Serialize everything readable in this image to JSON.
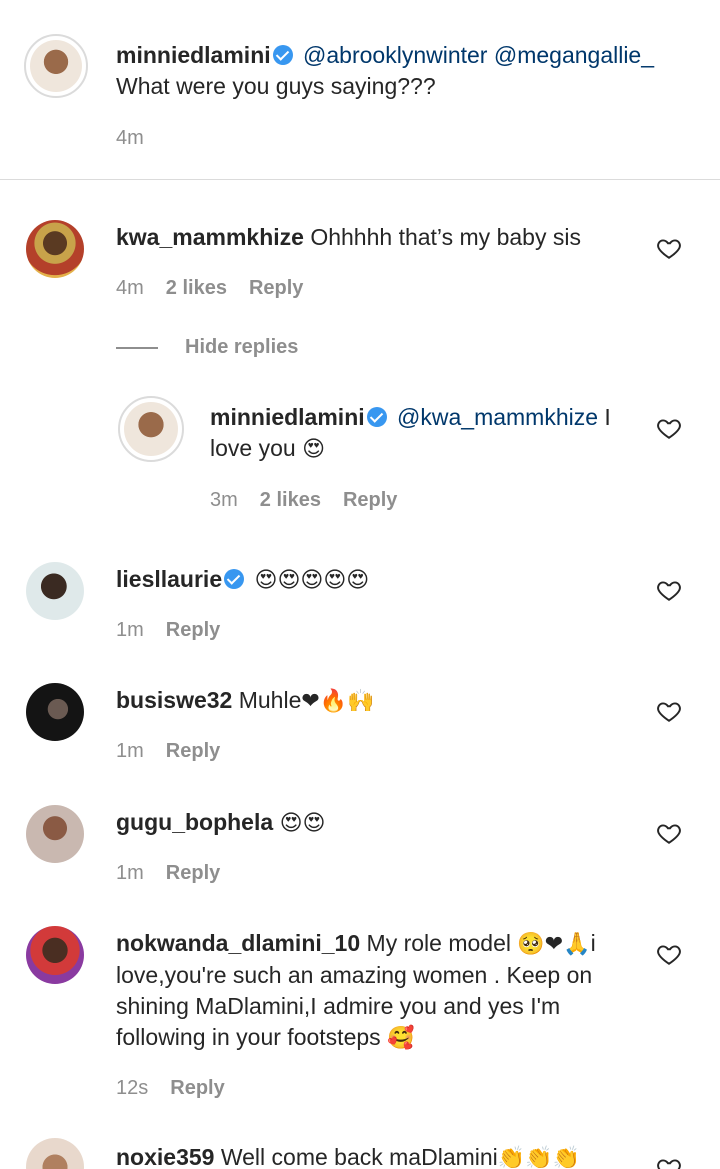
{
  "caption": {
    "username": "minniedlamini",
    "mentions": "@abrooklynwinter @megangallie_",
    "text": "What were you guys saying???",
    "time": "4m"
  },
  "comments": [
    {
      "username": "kwa_mammkhize",
      "text": "Ohhhhh that’s my baby sis",
      "time": "4m",
      "likes": "2 likes",
      "reply": "Reply",
      "hide_replies": "Hide replies"
    },
    {
      "username": "minniedlamini",
      "mention": "@kwa_mammkhize",
      "text_a": " I",
      "text_b": "love you",
      "emoji": "😍",
      "time": "3m",
      "likes": "2 likes",
      "reply": "Reply"
    },
    {
      "username": "liesllaurie",
      "emoji": "😍😍😍😍😍",
      "time": "1m",
      "reply": "Reply"
    },
    {
      "username": "busiswe32",
      "text": "Muhle",
      "emoji": "❤🔥🙌",
      "time": "1m",
      "reply": "Reply"
    },
    {
      "username": "gugu_bophela",
      "emoji": "😍😍",
      "time": "1m",
      "reply": "Reply"
    },
    {
      "username": "nokwanda_dlamini_10",
      "text_a": "My role model",
      "emoji_a": "🥺❤🙏",
      "text_b": "i",
      "line2": "love,you're such an amazing women . Keep on",
      "line3": "shining MaDlamini,I admire you and yes I'm",
      "line4": "following in your footsteps",
      "emoji_b": "🥰",
      "time": "12s",
      "reply": "Reply"
    },
    {
      "username": "noxie359",
      "text": "Well come back maDlamini",
      "emoji": "👏👏👏"
    }
  ],
  "colors": {
    "text": "#262626",
    "secondary": "#8e8e8e",
    "mention": "#00376b",
    "verified": "#3897f0",
    "divider": "#dbdbdb"
  },
  "icons": {
    "verified": "verified-badge-icon",
    "like": "heart-outline-icon"
  }
}
